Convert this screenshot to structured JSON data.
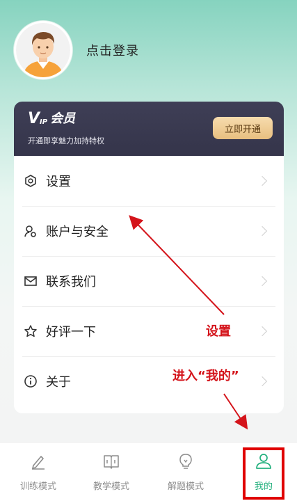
{
  "profile": {
    "login_label": "点击登录"
  },
  "vip": {
    "logo_v": "V",
    "logo_ip": "IP",
    "logo_member": "会员",
    "subtitle": "开通即享魅力加持特权",
    "button_label": "立即开通"
  },
  "menu": {
    "items": [
      {
        "label": "设置",
        "icon": "settings-icon"
      },
      {
        "label": "账户与安全",
        "icon": "account-security-icon"
      },
      {
        "label": "联系我们",
        "icon": "contact-icon"
      },
      {
        "label": "好评一下",
        "icon": "star-icon"
      },
      {
        "label": "关于",
        "icon": "info-icon"
      }
    ]
  },
  "tabbar": {
    "tabs": [
      {
        "label": "训练模式",
        "icon": "pen-icon"
      },
      {
        "label": "教学模式",
        "icon": "book-icon"
      },
      {
        "label": "解题模式",
        "icon": "lightbulb-icon"
      },
      {
        "label": "我的",
        "icon": "user-icon",
        "active": true
      }
    ]
  },
  "annotations": {
    "settings_note": "设置",
    "enter_mine_note": "进入“我的”"
  },
  "colors": {
    "accent_green": "#24b07e",
    "vip_bg": "#3a3a50",
    "vip_button": "#f0cc90",
    "annotation_red": "#d4141b"
  }
}
